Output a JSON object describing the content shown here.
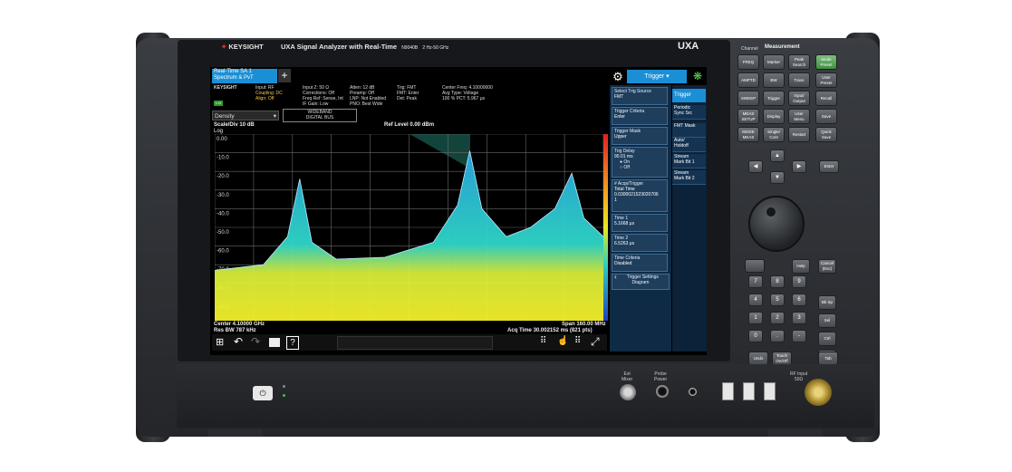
{
  "device": {
    "brand": "KEYSIGHT",
    "model_title": "UXA Signal Analyzer with Real-Time",
    "model_number": "N9040B",
    "freq_range": "2 Hz-50 GHz",
    "badge": "UXA"
  },
  "screen": {
    "tab_label": "Real-Time SA 1\nSpectrum & PvT",
    "add_tab": "+",
    "brand_small": "KEYSIGHT",
    "lxi_badge": "LXI",
    "status_col1": [
      "Input: RF",
      "Coupling: DC",
      "Align: Off"
    ],
    "status_col2": [
      "Input Z: 50 Ω",
      "Corrections: Off",
      "Freq Ref: Sense, Int",
      "IF Gain: Low"
    ],
    "status_col3": [
      "Atten: 12 dB",
      "Preamp: Off",
      "LNP: Not Enabled",
      "PNO: Best Wide"
    ],
    "status_col4": [
      "Trig: FMT",
      "FMT: Enter",
      "Det: Peak"
    ],
    "status_col5": [
      "Center Freq: 4.10000000",
      "Avg Type: Voltage",
      "100 % PCT: 5.967 μs"
    ],
    "density_label": "Density",
    "wideband_label": "WIDEBAND\nDIGITAL BUS",
    "scale_label": "Scale/Div 10 dB",
    "log_label": "Log",
    "ref_level": "Ref Level 0.00 dBm",
    "center_freq": "Center 4.10000 GHz",
    "res_bw": "Res BW 787 kHz",
    "span": "Span 160.00 MHz",
    "acq_time": "Acq Time 30.002152 ms (821 pts)",
    "trigger_header": "Trigger"
  },
  "trigger_panel": {
    "items": [
      {
        "title": "Select Trig Source",
        "value": "FMT"
      },
      {
        "title": "Trigger Criteria",
        "value": "Enter"
      },
      {
        "title": "Trigger Mask",
        "value": "Upper"
      },
      {
        "title": "Trig Delay",
        "value": "90.01 ms",
        "on": "On",
        "off": "Off"
      },
      {
        "title": "# Acqs/Trigger",
        "value": "Total Time\n0.0300021523020706\n1"
      },
      {
        "title": "Time 1",
        "value": "5.1668 μs"
      },
      {
        "title": "Time 2",
        "value": "6.5263 μs"
      },
      {
        "title": "Time Criteria",
        "value": "Disabled"
      }
    ],
    "settings_diagram": "Trigger Settings\nDiagram"
  },
  "side_tabs": [
    "Trigger",
    "Periodic\nSync Src",
    "FMT Mask",
    "Auto/\nHoldoff",
    "Stream\nMark Bit 1",
    "Stream\nMark Bit 2"
  ],
  "chart_data": {
    "type": "line",
    "title": "",
    "ylabel": "",
    "xlabel": "",
    "y_tick_labels": [
      "0.00",
      "-10.0",
      "-20.0",
      "-30.0",
      "-40.0",
      "-50.0",
      "-60.0",
      "-70.0",
      "-80.0",
      "-90.0"
    ],
    "ylim": [
      -100,
      0
    ],
    "xlim_ghz": [
      4.02,
      4.18
    ],
    "series": [
      {
        "values_x_ghz": [
          4.02,
          4.04,
          4.05,
          4.055,
          4.06,
          4.07,
          4.09,
          4.11,
          4.12,
          4.125,
          4.13,
          4.14,
          4.15,
          4.16,
          4.167,
          4.172,
          4.18
        ],
        "values_db": [
          -73,
          -70,
          -55,
          -24,
          -58,
          -67,
          -66,
          -58,
          -38,
          -9,
          -40,
          -55,
          -50,
          -40,
          -21,
          -45,
          -55
        ]
      }
    ]
  },
  "measurement_panel": {
    "header": "Measurement",
    "channel_label": "Channel",
    "keys": [
      [
        "FREQ",
        "Marker",
        "Peak\nSearch",
        "Mode\nPreset"
      ],
      [
        "AMPTD",
        "BW",
        "Trace",
        "User\nPreset"
      ],
      [
        "SWEEP",
        "Trigger",
        "Input/\nOutput",
        "Recall"
      ],
      [
        "MEAS\nSETUP",
        "Display",
        "User\nMenu",
        "Save"
      ],
      [
        "MODE\nMEAS",
        "Single/\nCont",
        "Restart",
        "Quick\nSave"
      ]
    ],
    "enter_label": "Enter",
    "numpad": [
      "7",
      "8",
      "9",
      "4",
      "5",
      "6",
      "1",
      "2",
      "3",
      "0",
      ".",
      "-"
    ],
    "side_keys": [
      "Help",
      "Cancel\n(Esc)",
      "Bk Sp",
      "Sel",
      "Ctrl",
      "Alt",
      "Tab"
    ],
    "bottom_keys": [
      "Undo",
      "Touch\nOn/Off",
      "Tab"
    ]
  },
  "front_panel": {
    "ext_mixer": "Ext\nMixer",
    "probe_power": "Probe\nPower",
    "rf_input": "RF Input\n50Ω"
  }
}
